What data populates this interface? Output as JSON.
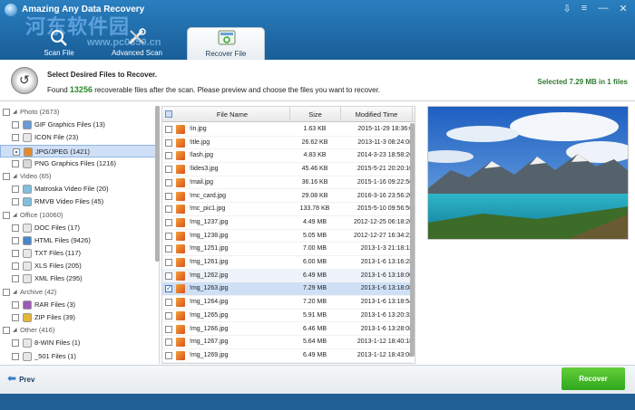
{
  "app": {
    "title": "Amazing Any Data Recovery",
    "watermark": "河东软件园",
    "watermark_url": "www.pc0359.cn",
    "window_controls": [
      "⇩",
      "≡",
      "—",
      "✕"
    ]
  },
  "tabs": [
    {
      "label": "Scan File",
      "icon": "scan-icon",
      "active": false
    },
    {
      "label": "Advanced Scan",
      "icon": "tools-icon",
      "active": false
    },
    {
      "label": "Recover File",
      "icon": "recover-icon",
      "active": true
    }
  ],
  "info": {
    "title": "Select Desired Files to Recover.",
    "sub_prefix": "Found",
    "count": "13256",
    "sub_suffix": "recoverable files after the scan. Please preview and choose the files you want to recover.",
    "selected": "Selected 7.29 MB in 1 files"
  },
  "tree": [
    {
      "label": "Photo (2673)",
      "group": true,
      "indent": 0,
      "check": false
    },
    {
      "label": "GIF Graphics Files (13)",
      "indent": 1,
      "icon": "#6b9ad8",
      "check": false
    },
    {
      "label": "ICON File (23)",
      "indent": 1,
      "icon": "#e7e7e7",
      "check": false
    },
    {
      "label": "JPG/JPEG (1421)",
      "indent": 1,
      "icon": "#e58a2d",
      "check": true,
      "selected": true
    },
    {
      "label": "PNG Graphics Files (1216)",
      "indent": 1,
      "icon": "#d9d9d9",
      "check": false
    },
    {
      "label": "Video (65)",
      "group": true,
      "indent": 0,
      "check": false
    },
    {
      "label": "Matroska Video File (20)",
      "indent": 1,
      "icon": "#7fbfe0",
      "check": false
    },
    {
      "label": "RMVB Video Files (45)",
      "indent": 1,
      "icon": "#7fbfe0",
      "check": false
    },
    {
      "label": "Office (10060)",
      "group": true,
      "indent": 0,
      "check": false
    },
    {
      "label": "DOC Files (17)",
      "indent": 1,
      "icon": "#e7e7e7",
      "check": false
    },
    {
      "label": "HTML Files (9426)",
      "indent": 1,
      "icon": "#4a86c8",
      "check": false
    },
    {
      "label": "TXT Files (117)",
      "indent": 1,
      "icon": "#e7e7e7",
      "check": false
    },
    {
      "label": "XLS Files (205)",
      "indent": 1,
      "icon": "#e7e7e7",
      "check": false
    },
    {
      "label": "XML Files (295)",
      "indent": 1,
      "icon": "#e7e7e7",
      "check": false
    },
    {
      "label": "Archive (42)",
      "group": true,
      "indent": 0,
      "check": false
    },
    {
      "label": "RAR Files (3)",
      "indent": 1,
      "icon": "#9b5bb5",
      "check": false
    },
    {
      "label": "ZIP Files (39)",
      "indent": 1,
      "icon": "#e6b635",
      "check": false
    },
    {
      "label": "Other (416)",
      "group": true,
      "indent": 0,
      "check": false
    },
    {
      "label": "8-WIN Files (1)",
      "indent": 1,
      "icon": "#e7e7e7",
      "check": false
    },
    {
      "label": "_501 Files (1)",
      "indent": 1,
      "icon": "#e7e7e7",
      "check": false
    }
  ],
  "table": {
    "headers": [
      "File Name",
      "Size",
      "Modified Time"
    ],
    "rows": [
      {
        "name": "!in.jpg",
        "size": "1.63 KB",
        "mtime": "2015-11-29 18:36:0"
      },
      {
        "name": "!itle.jpg",
        "size": "26.62 KB",
        "mtime": "2013-11-3 08:24:08"
      },
      {
        "name": "!lash.jpg",
        "size": "4.83 KB",
        "mtime": "2014-3-23 18:58:26"
      },
      {
        "name": "!lides3.jpg",
        "size": "45.46 KB",
        "mtime": "2015-5-21 20:20:10"
      },
      {
        "name": "!mail.jpg",
        "size": "36.16 KB",
        "mtime": "2015-1-16 09:22:56"
      },
      {
        "name": "!mc_card.jpg",
        "size": "29.08 KB",
        "mtime": "2016-3-16 23:56:20"
      },
      {
        "name": "!mc_pic1.jpg",
        "size": "133.78 KB",
        "mtime": "2015-5-10 09:56:56"
      },
      {
        "name": "!mg_1237.jpg",
        "size": "4.49 MB",
        "mtime": "2012-12-25 06:18:20"
      },
      {
        "name": "!mg_1238.jpg",
        "size": "5.05 MB",
        "mtime": "2012-12-27 16:34:22"
      },
      {
        "name": "!mg_1251.jpg",
        "size": "7.00 MB",
        "mtime": "2013-1-3 21:18:12"
      },
      {
        "name": "!mg_1261.jpg",
        "size": "6.00 MB",
        "mtime": "2013-1-6 13:16:28"
      },
      {
        "name": "!mg_1262.jpg",
        "size": "6.49 MB",
        "mtime": "2013-1-6 13:18:00",
        "hover": true
      },
      {
        "name": "!mg_1263.jpg",
        "size": "7.29 MB",
        "mtime": "2013-1-6 13:18:08",
        "checked": true,
        "selected": true
      },
      {
        "name": "!mg_1264.jpg",
        "size": "7.20 MB",
        "mtime": "2013-1-6 13:18:54"
      },
      {
        "name": "!mg_1265.jpg",
        "size": "5.91 MB",
        "mtime": "2013-1-6 13:20:32"
      },
      {
        "name": "!mg_1266.jpg",
        "size": "6.46 MB",
        "mtime": "2013-1-6 13:28:08"
      },
      {
        "name": "!mg_1267.jpg",
        "size": "5.64 MB",
        "mtime": "2013-1-12 18:40:18"
      },
      {
        "name": "!mg_1269.jpg",
        "size": "6.49 MB",
        "mtime": "2013-1-12 18:43:06"
      }
    ]
  },
  "buttons": {
    "prev": "Prev",
    "recover": "Recover"
  },
  "colors": {
    "accent": "#1f6aa7",
    "recover": "#3bb827",
    "selection": "#cfe0f6"
  }
}
